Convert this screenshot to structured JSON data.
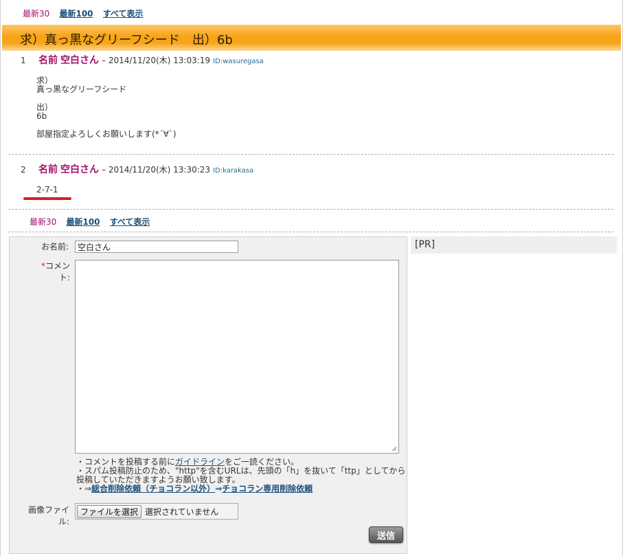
{
  "nav": {
    "latest30": "最新30",
    "latest100": "最新100",
    "all": "すべて表示"
  },
  "thread_title": "求）真っ黒なグリーフシード　出）6b",
  "posts": [
    {
      "num": "1",
      "name_label": "名前",
      "name": "空白さん",
      "date": "– 2014/11/20(木) 13:03:19",
      "id": "ID:wasuregasa",
      "lines": [
        "求）",
        "真っ黒なグリーフシード",
        "出）",
        "6b",
        "部屋指定よろしくお願いします(*´∀`)"
      ]
    },
    {
      "num": "2",
      "name_label": "名前",
      "name": "空白さん",
      "date": "– 2014/11/20(木) 13:30:23",
      "id": "ID:karakasa",
      "lines": [
        "2-7-1"
      ]
    }
  ],
  "form": {
    "name_label": "お名前:",
    "name_value": "空白さん",
    "comment_required_mark": "*",
    "comment_label": "コメント:",
    "note1_prefix": "・コメントを投稿する前に",
    "note1_link": "ガイドライン",
    "note1_suffix": "をご一読ください。",
    "note2": "・スパム投稿防止のため、\"http\"を含むURLは、先頭の「h」を抜いて「ttp」としてから投稿していただきますようお願い致します。",
    "note3_prefix": "・⇒",
    "note3_link1": "総合削除依頼（チョコラン以外）",
    "note3_arrow": "⇒",
    "note3_link2": "チョコラン専用削除依頼",
    "file_label": "画像ファイル:",
    "file_button": "ファイルを選択",
    "file_status": "選択されていません",
    "submit": "送信"
  },
  "pr": "[PR]"
}
